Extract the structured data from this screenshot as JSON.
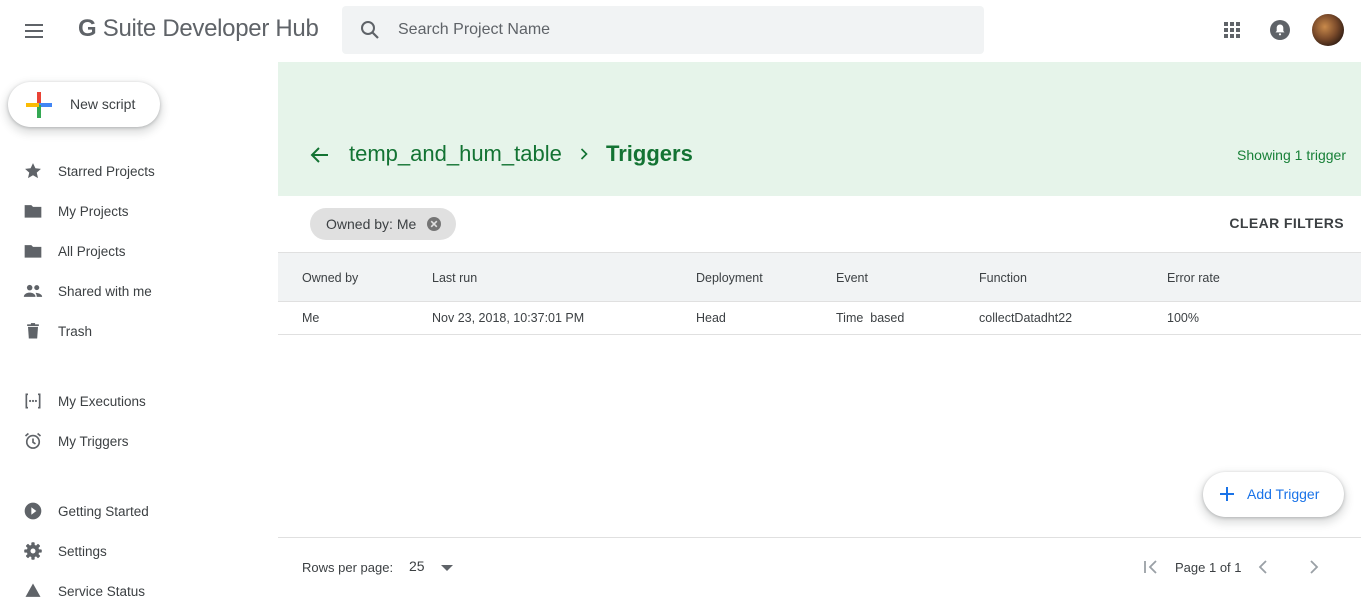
{
  "app": {
    "brand_g": "G",
    "brand_rest": " Suite Developer Hub"
  },
  "search": {
    "placeholder": "Search Project Name"
  },
  "sidebar": {
    "new_script": "New script",
    "items": [
      {
        "label": "Starred Projects",
        "icon": "star-icon"
      },
      {
        "label": "My Projects",
        "icon": "folder-icon"
      },
      {
        "label": "All Projects",
        "icon": "folder-icon"
      },
      {
        "label": "Shared with me",
        "icon": "people-icon"
      },
      {
        "label": "Trash",
        "icon": "trash-icon"
      },
      {
        "label": "My Executions",
        "icon": "executions-icon"
      },
      {
        "label": "My Triggers",
        "icon": "alarm-icon"
      },
      {
        "label": "Getting Started",
        "icon": "play-icon"
      },
      {
        "label": "Settings",
        "icon": "gear-icon"
      },
      {
        "label": "Service Status",
        "icon": "status-icon"
      }
    ]
  },
  "header": {
    "project": "temp_and_hum_table",
    "current": "Triggers",
    "showing": "Showing 1 trigger",
    "band_color": "#e6f4ea",
    "accent_color": "#137333"
  },
  "filters": {
    "chip": "Owned by: Me",
    "clear": "CLEAR FILTERS"
  },
  "table": {
    "columns": [
      "Owned by",
      "Last run",
      "Deployment",
      "Event",
      "Function",
      "Error rate"
    ],
    "rows": [
      [
        "Me",
        "Nov 23, 2018, 10:37:01 PM",
        "Head",
        "Time  based",
        "collectDatadht22",
        "100%"
      ]
    ]
  },
  "add_trigger": "Add Trigger",
  "footer": {
    "rows_per_page_label": "Rows per page:",
    "rows_per_page_value": "25",
    "page_info": "Page 1 of 1"
  }
}
